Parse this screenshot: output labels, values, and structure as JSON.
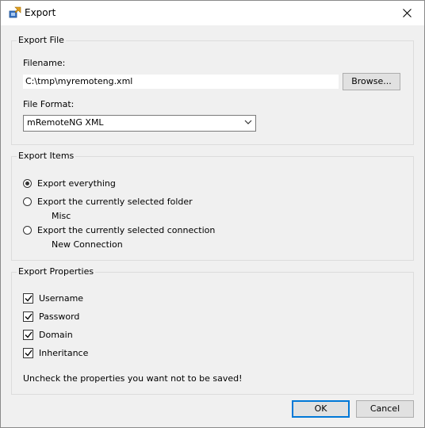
{
  "window": {
    "title": "Export"
  },
  "export_file": {
    "group_title": "Export File",
    "filename_label": "Filename:",
    "filename_value": "C:\\tmp\\myremoteng.xml",
    "browse_label": "Browse...",
    "format_label": "File Format:",
    "format_selected": "mRemoteNG XML"
  },
  "export_items": {
    "group_title": "Export Items",
    "options": [
      {
        "label": "Export everything",
        "checked": true
      },
      {
        "label": "Export the currently selected folder",
        "checked": false,
        "sub": "Misc"
      },
      {
        "label": "Export the currently selected connection",
        "checked": false,
        "sub": "New Connection"
      }
    ]
  },
  "export_properties": {
    "group_title": "Export Properties",
    "items": [
      {
        "label": "Username",
        "checked": true
      },
      {
        "label": "Password",
        "checked": true
      },
      {
        "label": "Domain",
        "checked": true
      },
      {
        "label": "Inheritance",
        "checked": true
      }
    ],
    "hint": "Uncheck the properties you want not to be saved!"
  },
  "footer": {
    "ok_label": "OK",
    "cancel_label": "Cancel"
  },
  "colors": {
    "focus_accent": "#0078d7",
    "window_bg": "#f0f0f0"
  }
}
